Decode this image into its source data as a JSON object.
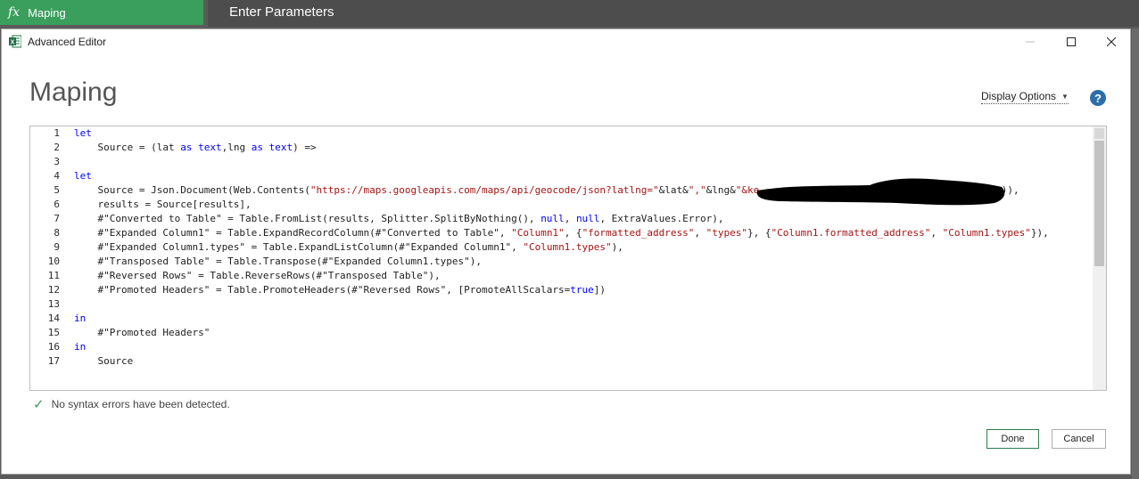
{
  "background": {
    "query_name": "Maping",
    "fx_symbol": "fx",
    "header_text": "Enter Parameters"
  },
  "dialog": {
    "title": "Advanced Editor",
    "heading": "Maping",
    "display_options_label": "Display Options",
    "help_symbol": "?",
    "status_text": "No syntax errors have been detected.",
    "done_label": "Done",
    "cancel_label": "Cancel"
  },
  "editor": {
    "line_numbers": [
      "1",
      "2",
      "3",
      "4",
      "5",
      "6",
      "7",
      "8",
      "9",
      "10",
      "11",
      "12",
      "13",
      "14",
      "15",
      "16",
      "17"
    ],
    "lines": [
      [
        {
          "t": "let",
          "c": "kw"
        }
      ],
      [
        {
          "t": "    Source = (lat ",
          "c": ""
        },
        {
          "t": "as",
          "c": "kw"
        },
        {
          "t": " ",
          "c": ""
        },
        {
          "t": "text",
          "c": "kw"
        },
        {
          "t": ",lng ",
          "c": ""
        },
        {
          "t": "as",
          "c": "kw"
        },
        {
          "t": " ",
          "c": ""
        },
        {
          "t": "text",
          "c": "kw"
        },
        {
          "t": ") =>",
          "c": ""
        }
      ],
      [],
      [
        {
          "t": "let",
          "c": "kw"
        }
      ],
      [
        {
          "t": "    Source = Json.Document(Web.Contents(",
          "c": ""
        },
        {
          "t": "\"https://maps.googleapis.com/maps/api/geocode/json?latlng=\"",
          "c": "str"
        },
        {
          "t": "&lat&",
          "c": ""
        },
        {
          "t": "\",\"",
          "c": "str"
        },
        {
          "t": "&lng&",
          "c": ""
        },
        {
          "t": "\"&ke",
          "c": "str"
        },
        {
          "t": "                                         ",
          "c": ""
        },
        {
          "t": ")),",
          "c": ""
        }
      ],
      [
        {
          "t": "    results = Source[results],",
          "c": ""
        }
      ],
      [
        {
          "t": "    #\"Converted to Table\" = Table.FromList(results, Splitter.SplitByNothing(), ",
          "c": ""
        },
        {
          "t": "null",
          "c": "kw"
        },
        {
          "t": ", ",
          "c": ""
        },
        {
          "t": "null",
          "c": "kw"
        },
        {
          "t": ", ExtraValues.Error),",
          "c": ""
        }
      ],
      [
        {
          "t": "    #\"Expanded Column1\" = Table.ExpandRecordColumn(#\"Converted to Table\", ",
          "c": ""
        },
        {
          "t": "\"Column1\"",
          "c": "str"
        },
        {
          "t": ", {",
          "c": ""
        },
        {
          "t": "\"formatted_address\"",
          "c": "str"
        },
        {
          "t": ", ",
          "c": ""
        },
        {
          "t": "\"types\"",
          "c": "str"
        },
        {
          "t": "}, {",
          "c": ""
        },
        {
          "t": "\"Column1.formatted_address\"",
          "c": "str"
        },
        {
          "t": ", ",
          "c": ""
        },
        {
          "t": "\"Column1.types\"",
          "c": "str"
        },
        {
          "t": "}),",
          "c": ""
        }
      ],
      [
        {
          "t": "    #\"Expanded Column1.types\" = Table.ExpandListColumn(#\"Expanded Column1\", ",
          "c": ""
        },
        {
          "t": "\"Column1.types\"",
          "c": "str"
        },
        {
          "t": "),",
          "c": ""
        }
      ],
      [
        {
          "t": "    #\"Transposed Table\" = Table.Transpose(#\"Expanded Column1.types\"),",
          "c": ""
        }
      ],
      [
        {
          "t": "    #\"Reversed Rows\" = Table.ReverseRows(#\"Transposed Table\"),",
          "c": ""
        }
      ],
      [
        {
          "t": "    #\"Promoted Headers\" = Table.PromoteHeaders(#\"Reversed Rows\", [PromoteAllScalars=",
          "c": ""
        },
        {
          "t": "true",
          "c": "kw"
        },
        {
          "t": "])",
          "c": ""
        }
      ],
      [],
      [
        {
          "t": "in",
          "c": "kw"
        }
      ],
      [
        {
          "t": "    #\"Promoted Headers\"",
          "c": ""
        }
      ],
      [
        {
          "t": "in",
          "c": "kw"
        }
      ],
      [
        {
          "t": "    Source",
          "c": ""
        }
      ]
    ]
  },
  "colors": {
    "keyword": "#0000ff",
    "string": "#a31515",
    "accent_green": "#3a9e5c",
    "help_blue": "#2d6ea9"
  },
  "icons": [
    "excel-icon",
    "minimize-icon",
    "maximize-icon",
    "close-icon",
    "help-icon",
    "check-icon"
  ]
}
